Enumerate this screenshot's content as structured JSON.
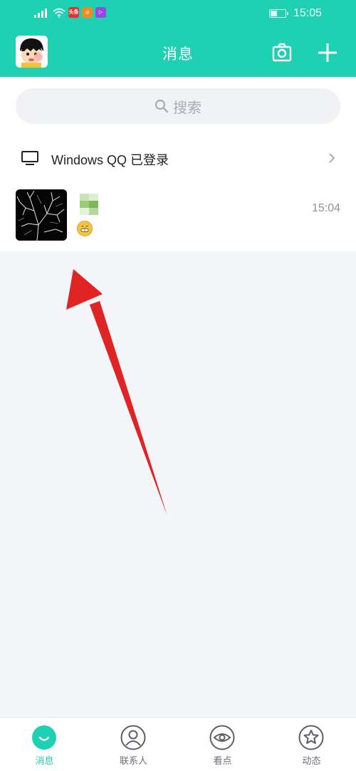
{
  "status_bar": {
    "time": "15:05",
    "network": "4G",
    "battery_level": 0.45,
    "app_badges": [
      {
        "name": "toutiao-badge",
        "color": "#e8322f",
        "label": "头条"
      },
      {
        "name": "weibo-badge",
        "color": "#f08a22",
        "label": ""
      },
      {
        "name": "video-badge",
        "color": "#9b45e0",
        "label": ""
      }
    ]
  },
  "header": {
    "title": "消息",
    "accent_color": "#1ed1b3"
  },
  "search": {
    "placeholder": "搜索"
  },
  "pc_login": {
    "label": "Windows QQ 已登录"
  },
  "chats": [
    {
      "time": "15:04",
      "preview_emoji": "grin-emoji"
    }
  ],
  "tabs": [
    {
      "label": "消息",
      "icon": "message-bubble-icon",
      "active": true
    },
    {
      "label": "联系人",
      "icon": "contacts-person-icon",
      "active": false
    },
    {
      "label": "看点",
      "icon": "eye-icon",
      "active": false
    },
    {
      "label": "动态",
      "icon": "star-icon",
      "active": false
    }
  ]
}
